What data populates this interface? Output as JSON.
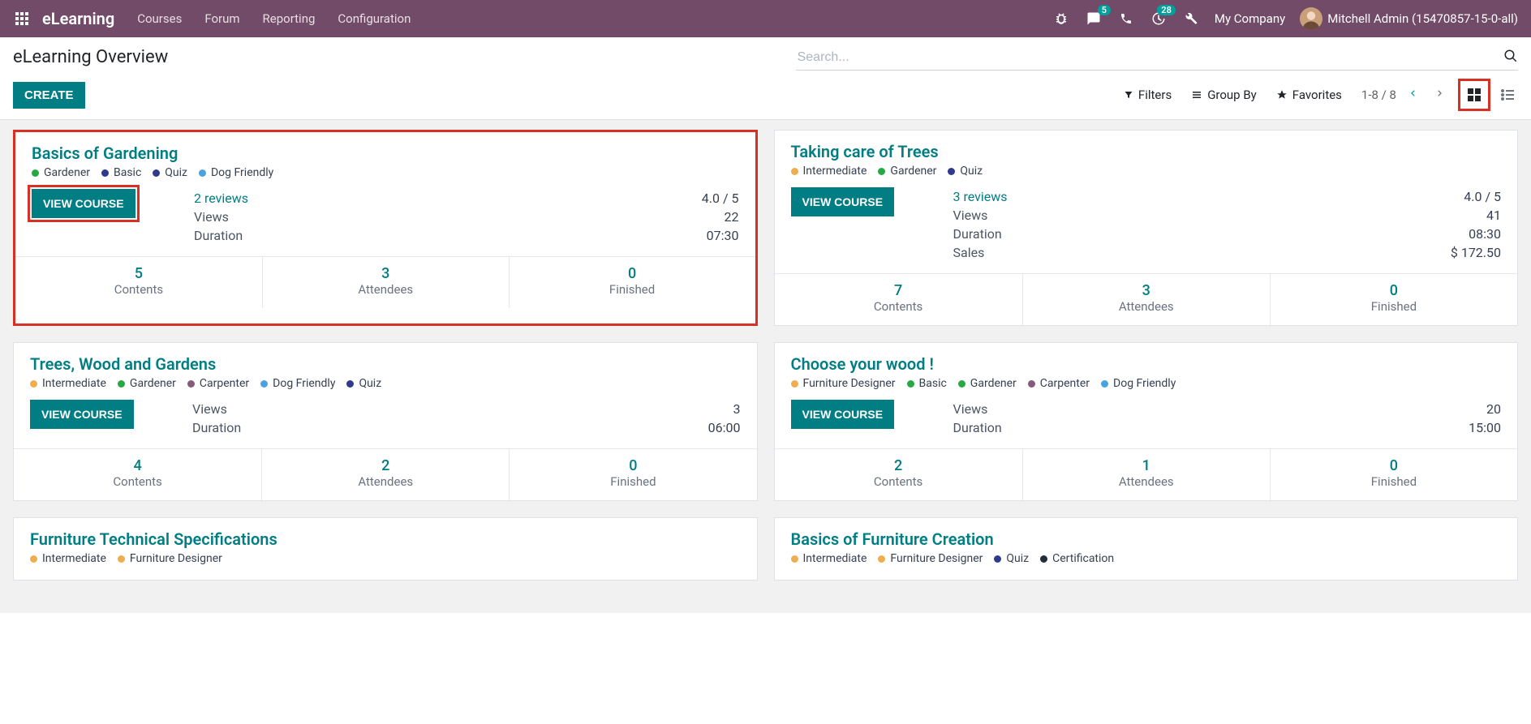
{
  "nav": {
    "brand": "eLearning",
    "menu": [
      "Courses",
      "Forum",
      "Reporting",
      "Configuration"
    ],
    "messages_badge": "5",
    "activities_badge": "28",
    "company": "My Company",
    "user": "Mitchell Admin (15470857-15-0-all)"
  },
  "page": {
    "title": "eLearning Overview",
    "create": "CREATE",
    "search_placeholder": "Search...",
    "filters": "Filters",
    "group_by": "Group By",
    "favorites": "Favorites",
    "pager": "1-8 / 8"
  },
  "tag_colors": {
    "green": "#28a745",
    "navy": "#2f3a8f",
    "lightblue": "#4aa3df",
    "yellow": "#f0ad4e",
    "purple": "#875A7B",
    "dark": "#1f2d3d"
  },
  "labels": {
    "view_course": "VIEW COURSE",
    "views": "Views",
    "duration": "Duration",
    "sales": "Sales",
    "contents": "Contents",
    "attendees": "Attendees",
    "finished": "Finished"
  },
  "cards": [
    {
      "title": "Basics of Gardening",
      "highlight_card": true,
      "highlight_button": true,
      "tags": [
        {
          "label": "Gardener",
          "color": "green"
        },
        {
          "label": "Basic",
          "color": "navy"
        },
        {
          "label": "Quiz",
          "color": "navy"
        },
        {
          "label": "Dog Friendly",
          "color": "lightblue"
        }
      ],
      "reviews": {
        "count": "2 reviews",
        "rating": "4.0 / 5"
      },
      "views": "22",
      "duration": "07:30",
      "sales": null,
      "footer": {
        "contents": "5",
        "attendees": "3",
        "finished": "0"
      }
    },
    {
      "title": "Taking care of Trees",
      "tags": [
        {
          "label": "Intermediate",
          "color": "yellow"
        },
        {
          "label": "Gardener",
          "color": "green"
        },
        {
          "label": "Quiz",
          "color": "navy"
        }
      ],
      "reviews": {
        "count": "3 reviews",
        "rating": "4.0 / 5"
      },
      "views": "41",
      "duration": "08:30",
      "sales": "$ 172.50",
      "footer": {
        "contents": "7",
        "attendees": "3",
        "finished": "0"
      }
    },
    {
      "title": "Trees, Wood and Gardens",
      "tags": [
        {
          "label": "Intermediate",
          "color": "yellow"
        },
        {
          "label": "Gardener",
          "color": "green"
        },
        {
          "label": "Carpenter",
          "color": "purple"
        },
        {
          "label": "Dog Friendly",
          "color": "lightblue"
        },
        {
          "label": "Quiz",
          "color": "navy"
        }
      ],
      "reviews": null,
      "views": "3",
      "duration": "06:00",
      "sales": null,
      "footer": {
        "contents": "4",
        "attendees": "2",
        "finished": "0"
      }
    },
    {
      "title": "Choose your wood !",
      "tags": [
        {
          "label": "Furniture Designer",
          "color": "yellow"
        },
        {
          "label": "Basic",
          "color": "green"
        },
        {
          "label": "Gardener",
          "color": "green"
        },
        {
          "label": "Carpenter",
          "color": "purple"
        },
        {
          "label": "Dog Friendly",
          "color": "lightblue"
        }
      ],
      "reviews": null,
      "views": "20",
      "duration": "15:00",
      "sales": null,
      "footer": {
        "contents": "2",
        "attendees": "1",
        "finished": "0"
      }
    },
    {
      "title": "Furniture Technical Specifications",
      "short": true,
      "tags": [
        {
          "label": "Intermediate",
          "color": "yellow"
        },
        {
          "label": "Furniture Designer",
          "color": "yellow"
        }
      ]
    },
    {
      "title": "Basics of Furniture Creation",
      "short": true,
      "tags": [
        {
          "label": "Intermediate",
          "color": "yellow"
        },
        {
          "label": "Furniture Designer",
          "color": "yellow"
        },
        {
          "label": "Quiz",
          "color": "navy"
        },
        {
          "label": "Certification",
          "color": "dark"
        }
      ]
    }
  ]
}
